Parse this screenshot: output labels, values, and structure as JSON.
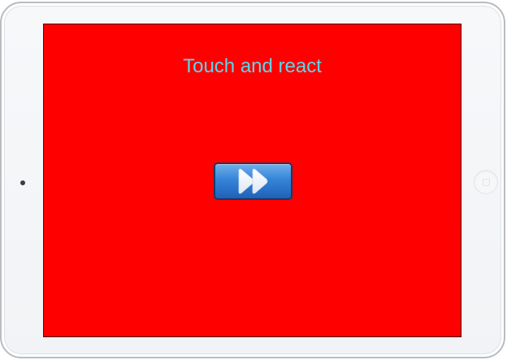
{
  "app": {
    "title": "Touch and react"
  },
  "screen": {
    "background_color": "#ff0000",
    "title_color": "#5fd5ea"
  },
  "controls": {
    "next_button_icon": "fast-forward-icon",
    "next_button_color": "#2a72c8"
  }
}
